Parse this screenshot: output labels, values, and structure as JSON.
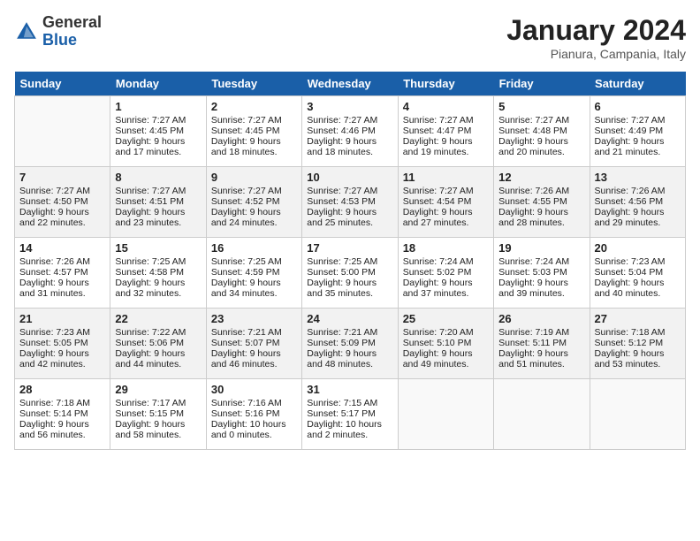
{
  "header": {
    "logo_general": "General",
    "logo_blue": "Blue",
    "month_title": "January 2024",
    "subtitle": "Pianura, Campania, Italy"
  },
  "days_of_week": [
    "Sunday",
    "Monday",
    "Tuesday",
    "Wednesday",
    "Thursday",
    "Friday",
    "Saturday"
  ],
  "weeks": [
    [
      {
        "day": "",
        "sunrise": "",
        "sunset": "",
        "daylight": ""
      },
      {
        "day": "1",
        "sunrise": "Sunrise: 7:27 AM",
        "sunset": "Sunset: 4:45 PM",
        "daylight": "Daylight: 9 hours and 17 minutes."
      },
      {
        "day": "2",
        "sunrise": "Sunrise: 7:27 AM",
        "sunset": "Sunset: 4:45 PM",
        "daylight": "Daylight: 9 hours and 18 minutes."
      },
      {
        "day": "3",
        "sunrise": "Sunrise: 7:27 AM",
        "sunset": "Sunset: 4:46 PM",
        "daylight": "Daylight: 9 hours and 18 minutes."
      },
      {
        "day": "4",
        "sunrise": "Sunrise: 7:27 AM",
        "sunset": "Sunset: 4:47 PM",
        "daylight": "Daylight: 9 hours and 19 minutes."
      },
      {
        "day": "5",
        "sunrise": "Sunrise: 7:27 AM",
        "sunset": "Sunset: 4:48 PM",
        "daylight": "Daylight: 9 hours and 20 minutes."
      },
      {
        "day": "6",
        "sunrise": "Sunrise: 7:27 AM",
        "sunset": "Sunset: 4:49 PM",
        "daylight": "Daylight: 9 hours and 21 minutes."
      }
    ],
    [
      {
        "day": "7",
        "sunrise": "Sunrise: 7:27 AM",
        "sunset": "Sunset: 4:50 PM",
        "daylight": "Daylight: 9 hours and 22 minutes."
      },
      {
        "day": "8",
        "sunrise": "Sunrise: 7:27 AM",
        "sunset": "Sunset: 4:51 PM",
        "daylight": "Daylight: 9 hours and 23 minutes."
      },
      {
        "day": "9",
        "sunrise": "Sunrise: 7:27 AM",
        "sunset": "Sunset: 4:52 PM",
        "daylight": "Daylight: 9 hours and 24 minutes."
      },
      {
        "day": "10",
        "sunrise": "Sunrise: 7:27 AM",
        "sunset": "Sunset: 4:53 PM",
        "daylight": "Daylight: 9 hours and 25 minutes."
      },
      {
        "day": "11",
        "sunrise": "Sunrise: 7:27 AM",
        "sunset": "Sunset: 4:54 PM",
        "daylight": "Daylight: 9 hours and 27 minutes."
      },
      {
        "day": "12",
        "sunrise": "Sunrise: 7:26 AM",
        "sunset": "Sunset: 4:55 PM",
        "daylight": "Daylight: 9 hours and 28 minutes."
      },
      {
        "day": "13",
        "sunrise": "Sunrise: 7:26 AM",
        "sunset": "Sunset: 4:56 PM",
        "daylight": "Daylight: 9 hours and 29 minutes."
      }
    ],
    [
      {
        "day": "14",
        "sunrise": "Sunrise: 7:26 AM",
        "sunset": "Sunset: 4:57 PM",
        "daylight": "Daylight: 9 hours and 31 minutes."
      },
      {
        "day": "15",
        "sunrise": "Sunrise: 7:25 AM",
        "sunset": "Sunset: 4:58 PM",
        "daylight": "Daylight: 9 hours and 32 minutes."
      },
      {
        "day": "16",
        "sunrise": "Sunrise: 7:25 AM",
        "sunset": "Sunset: 4:59 PM",
        "daylight": "Daylight: 9 hours and 34 minutes."
      },
      {
        "day": "17",
        "sunrise": "Sunrise: 7:25 AM",
        "sunset": "Sunset: 5:00 PM",
        "daylight": "Daylight: 9 hours and 35 minutes."
      },
      {
        "day": "18",
        "sunrise": "Sunrise: 7:24 AM",
        "sunset": "Sunset: 5:02 PM",
        "daylight": "Daylight: 9 hours and 37 minutes."
      },
      {
        "day": "19",
        "sunrise": "Sunrise: 7:24 AM",
        "sunset": "Sunset: 5:03 PM",
        "daylight": "Daylight: 9 hours and 39 minutes."
      },
      {
        "day": "20",
        "sunrise": "Sunrise: 7:23 AM",
        "sunset": "Sunset: 5:04 PM",
        "daylight": "Daylight: 9 hours and 40 minutes."
      }
    ],
    [
      {
        "day": "21",
        "sunrise": "Sunrise: 7:23 AM",
        "sunset": "Sunset: 5:05 PM",
        "daylight": "Daylight: 9 hours and 42 minutes."
      },
      {
        "day": "22",
        "sunrise": "Sunrise: 7:22 AM",
        "sunset": "Sunset: 5:06 PM",
        "daylight": "Daylight: 9 hours and 44 minutes."
      },
      {
        "day": "23",
        "sunrise": "Sunrise: 7:21 AM",
        "sunset": "Sunset: 5:07 PM",
        "daylight": "Daylight: 9 hours and 46 minutes."
      },
      {
        "day": "24",
        "sunrise": "Sunrise: 7:21 AM",
        "sunset": "Sunset: 5:09 PM",
        "daylight": "Daylight: 9 hours and 48 minutes."
      },
      {
        "day": "25",
        "sunrise": "Sunrise: 7:20 AM",
        "sunset": "Sunset: 5:10 PM",
        "daylight": "Daylight: 9 hours and 49 minutes."
      },
      {
        "day": "26",
        "sunrise": "Sunrise: 7:19 AM",
        "sunset": "Sunset: 5:11 PM",
        "daylight": "Daylight: 9 hours and 51 minutes."
      },
      {
        "day": "27",
        "sunrise": "Sunrise: 7:18 AM",
        "sunset": "Sunset: 5:12 PM",
        "daylight": "Daylight: 9 hours and 53 minutes."
      }
    ],
    [
      {
        "day": "28",
        "sunrise": "Sunrise: 7:18 AM",
        "sunset": "Sunset: 5:14 PM",
        "daylight": "Daylight: 9 hours and 56 minutes."
      },
      {
        "day": "29",
        "sunrise": "Sunrise: 7:17 AM",
        "sunset": "Sunset: 5:15 PM",
        "daylight": "Daylight: 9 hours and 58 minutes."
      },
      {
        "day": "30",
        "sunrise": "Sunrise: 7:16 AM",
        "sunset": "Sunset: 5:16 PM",
        "daylight": "Daylight: 10 hours and 0 minutes."
      },
      {
        "day": "31",
        "sunrise": "Sunrise: 7:15 AM",
        "sunset": "Sunset: 5:17 PM",
        "daylight": "Daylight: 10 hours and 2 minutes."
      },
      {
        "day": "",
        "sunrise": "",
        "sunset": "",
        "daylight": ""
      },
      {
        "day": "",
        "sunrise": "",
        "sunset": "",
        "daylight": ""
      },
      {
        "day": "",
        "sunrise": "",
        "sunset": "",
        "daylight": ""
      }
    ]
  ]
}
